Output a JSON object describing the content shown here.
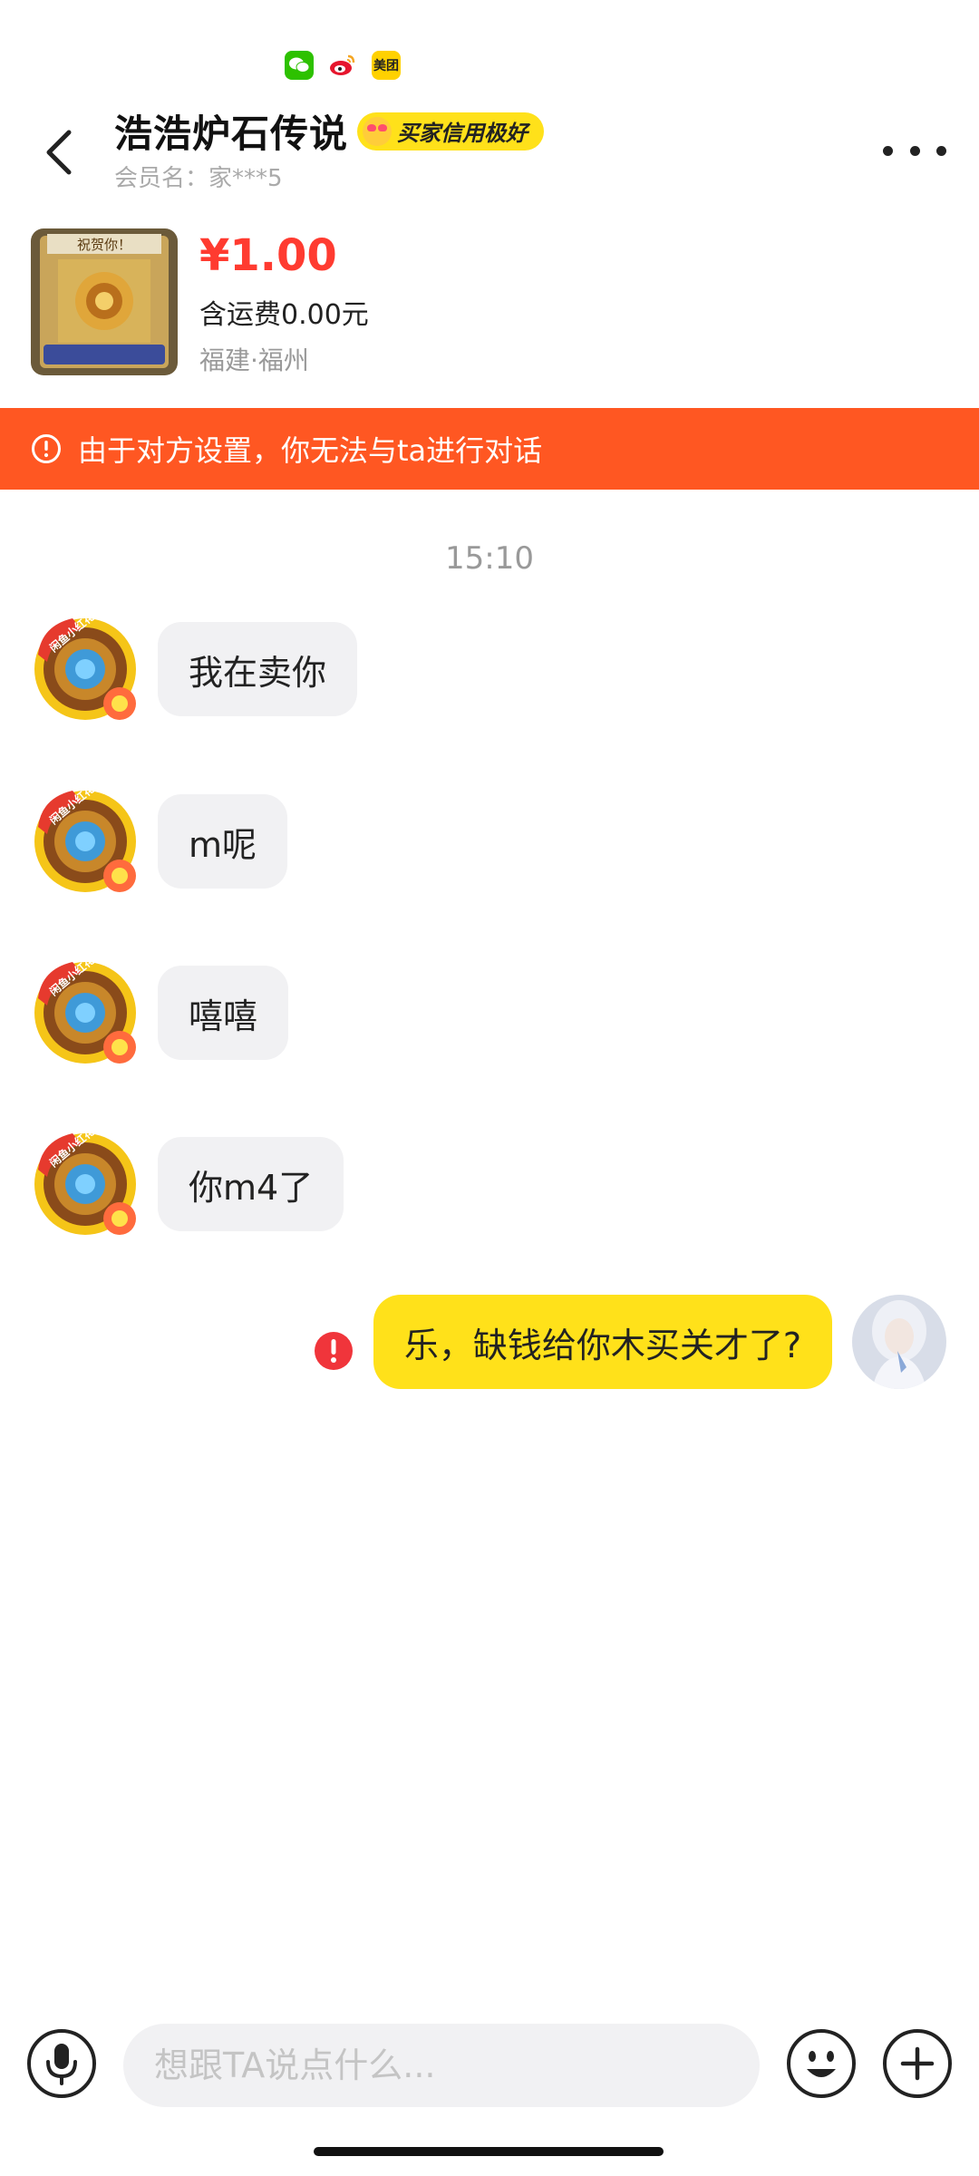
{
  "status_bar": {
    "icons": [
      "wechat-icon",
      "weibo-icon",
      "meituan-icon"
    ],
    "meituan_label": "美团"
  },
  "header": {
    "title": "浩浩炉石传说",
    "credit_badge": "买家信用极好",
    "member": "会员名：家***5"
  },
  "product": {
    "thumb_text": "祝贺你！",
    "price": "¥1.00",
    "shipping": "含运费0.00元",
    "location": "福建·福州"
  },
  "notice": {
    "text": "由于对方设置，你无法与ta进行对话",
    "color": "#ff5722"
  },
  "chat": {
    "timestamp": "15:10",
    "avatar_badge": "闲鱼小红花",
    "incoming": [
      {
        "text": "我在卖你"
      },
      {
        "text": "m呢"
      },
      {
        "text": "嘻嘻"
      },
      {
        "text": "你m4了"
      }
    ],
    "outgoing": {
      "text": "乐，缺钱给你木买关才了?",
      "status": "failed"
    }
  },
  "input_bar": {
    "placeholder": "想跟TA说点什么..."
  },
  "colors": {
    "accent_yellow": "#ffe11a",
    "price_red": "#ff3b30",
    "bubble_gray": "#f1f1f3"
  }
}
